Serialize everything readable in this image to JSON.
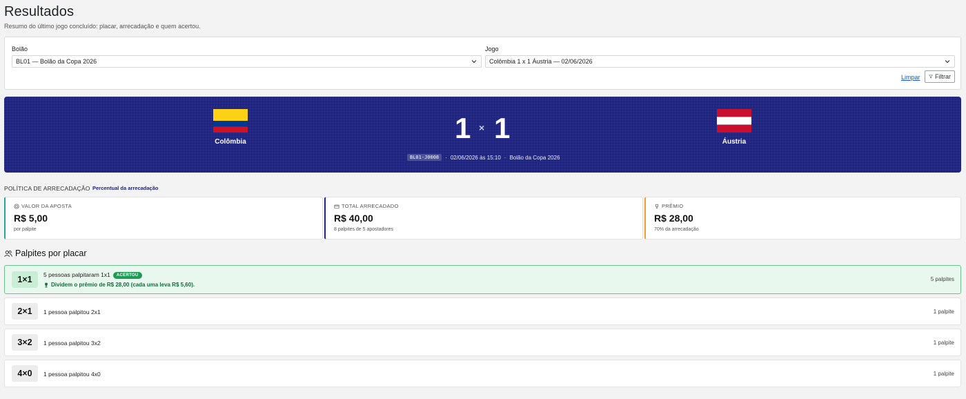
{
  "page": {
    "title": "Resultados",
    "subtitle": "Resumo do último jogo concluído: placar, arrecadação e quem acertou."
  },
  "filters": {
    "bolao_label": "Bolão",
    "bolao_value": "BL01 — Bolão da Copa 2026",
    "jogo_label": "Jogo",
    "jogo_value": "Colômbia 1 x 1 Áustria — 02/06/2026",
    "clear_label": "Limpar",
    "filter_label": "Filtrar"
  },
  "match": {
    "home_team": "Colômbia",
    "away_team": "Áustria",
    "home_score": "1",
    "separator": "×",
    "away_score": "1",
    "code": "BL01-J0008",
    "datetime": "02/06/2026 às 15:10",
    "bolao_name": "Bolão da Copa 2026",
    "home_flag_colors": [
      "#fcd116",
      "#003893",
      "#ce1126"
    ],
    "away_flag_colors": [
      "#c8102e",
      "#ffffff",
      "#c8102e"
    ]
  },
  "policy": {
    "label": "POLÍTICA DE ARRECADAÇÃO",
    "chip": "Percentual da arrecadação"
  },
  "kpis": [
    {
      "caption": "VALOR DA APOSTA",
      "value": "R$ 5,00",
      "sub": "por palpite",
      "icon": "coin-icon",
      "accent": "#26a69a"
    },
    {
      "caption": "TOTAL ARRECADADO",
      "value": "R$ 40,00",
      "sub": "8 palpites de 5 apostadores",
      "icon": "wallet-icon",
      "accent": "#1e2480"
    },
    {
      "caption": "PRÊMIO",
      "value": "R$ 28,00",
      "sub": "70% da arrecadação",
      "icon": "trophy-icon",
      "accent": "#f0a030"
    }
  ],
  "guesses": {
    "title": "Palpites por placar",
    "rows": [
      {
        "score": "1×1",
        "text": "5 pessoas palpitaram 1x1",
        "count": "5 palpites",
        "badge": "ACERTOU",
        "prize": "Dividem o prêmio de R$ 28,00 (cada uma leva R$ 5,60)."
      },
      {
        "score": "2×1",
        "text": "1 pessoa palpitou 2x1",
        "count": "1 palpite"
      },
      {
        "score": "3×2",
        "text": "1 pessoa palpitou 3x2",
        "count": "1 palpite"
      },
      {
        "score": "4×0",
        "text": "1 pessoa palpitou 4x0",
        "count": "1 palpite"
      }
    ]
  },
  "colors": {
    "hero_bg": "#1e2480",
    "success": "#1e9b56",
    "link": "#1a56c8"
  }
}
